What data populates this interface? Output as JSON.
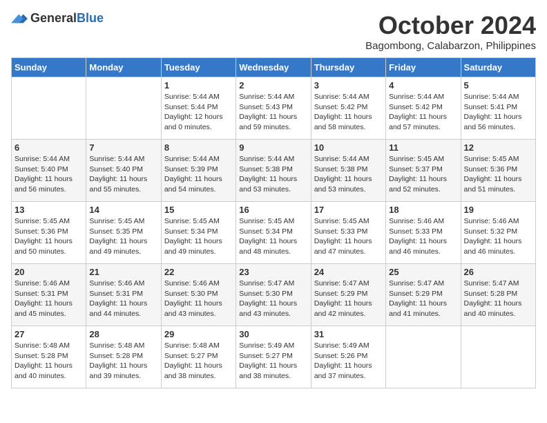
{
  "header": {
    "logo_general": "General",
    "logo_blue": "Blue",
    "month_title": "October 2024",
    "location": "Bagombong, Calabarzon, Philippines"
  },
  "days_of_week": [
    "Sunday",
    "Monday",
    "Tuesday",
    "Wednesday",
    "Thursday",
    "Friday",
    "Saturday"
  ],
  "weeks": [
    [
      {
        "day": "",
        "info": ""
      },
      {
        "day": "",
        "info": ""
      },
      {
        "day": "1",
        "info": "Sunrise: 5:44 AM\nSunset: 5:44 PM\nDaylight: 12 hours\nand 0 minutes."
      },
      {
        "day": "2",
        "info": "Sunrise: 5:44 AM\nSunset: 5:43 PM\nDaylight: 11 hours\nand 59 minutes."
      },
      {
        "day": "3",
        "info": "Sunrise: 5:44 AM\nSunset: 5:42 PM\nDaylight: 11 hours\nand 58 minutes."
      },
      {
        "day": "4",
        "info": "Sunrise: 5:44 AM\nSunset: 5:42 PM\nDaylight: 11 hours\nand 57 minutes."
      },
      {
        "day": "5",
        "info": "Sunrise: 5:44 AM\nSunset: 5:41 PM\nDaylight: 11 hours\nand 56 minutes."
      }
    ],
    [
      {
        "day": "6",
        "info": "Sunrise: 5:44 AM\nSunset: 5:40 PM\nDaylight: 11 hours\nand 56 minutes."
      },
      {
        "day": "7",
        "info": "Sunrise: 5:44 AM\nSunset: 5:40 PM\nDaylight: 11 hours\nand 55 minutes."
      },
      {
        "day": "8",
        "info": "Sunrise: 5:44 AM\nSunset: 5:39 PM\nDaylight: 11 hours\nand 54 minutes."
      },
      {
        "day": "9",
        "info": "Sunrise: 5:44 AM\nSunset: 5:38 PM\nDaylight: 11 hours\nand 53 minutes."
      },
      {
        "day": "10",
        "info": "Sunrise: 5:44 AM\nSunset: 5:38 PM\nDaylight: 11 hours\nand 53 minutes."
      },
      {
        "day": "11",
        "info": "Sunrise: 5:45 AM\nSunset: 5:37 PM\nDaylight: 11 hours\nand 52 minutes."
      },
      {
        "day": "12",
        "info": "Sunrise: 5:45 AM\nSunset: 5:36 PM\nDaylight: 11 hours\nand 51 minutes."
      }
    ],
    [
      {
        "day": "13",
        "info": "Sunrise: 5:45 AM\nSunset: 5:36 PM\nDaylight: 11 hours\nand 50 minutes."
      },
      {
        "day": "14",
        "info": "Sunrise: 5:45 AM\nSunset: 5:35 PM\nDaylight: 11 hours\nand 49 minutes."
      },
      {
        "day": "15",
        "info": "Sunrise: 5:45 AM\nSunset: 5:34 PM\nDaylight: 11 hours\nand 49 minutes."
      },
      {
        "day": "16",
        "info": "Sunrise: 5:45 AM\nSunset: 5:34 PM\nDaylight: 11 hours\nand 48 minutes."
      },
      {
        "day": "17",
        "info": "Sunrise: 5:45 AM\nSunset: 5:33 PM\nDaylight: 11 hours\nand 47 minutes."
      },
      {
        "day": "18",
        "info": "Sunrise: 5:46 AM\nSunset: 5:33 PM\nDaylight: 11 hours\nand 46 minutes."
      },
      {
        "day": "19",
        "info": "Sunrise: 5:46 AM\nSunset: 5:32 PM\nDaylight: 11 hours\nand 46 minutes."
      }
    ],
    [
      {
        "day": "20",
        "info": "Sunrise: 5:46 AM\nSunset: 5:31 PM\nDaylight: 11 hours\nand 45 minutes."
      },
      {
        "day": "21",
        "info": "Sunrise: 5:46 AM\nSunset: 5:31 PM\nDaylight: 11 hours\nand 44 minutes."
      },
      {
        "day": "22",
        "info": "Sunrise: 5:46 AM\nSunset: 5:30 PM\nDaylight: 11 hours\nand 43 minutes."
      },
      {
        "day": "23",
        "info": "Sunrise: 5:47 AM\nSunset: 5:30 PM\nDaylight: 11 hours\nand 43 minutes."
      },
      {
        "day": "24",
        "info": "Sunrise: 5:47 AM\nSunset: 5:29 PM\nDaylight: 11 hours\nand 42 minutes."
      },
      {
        "day": "25",
        "info": "Sunrise: 5:47 AM\nSunset: 5:29 PM\nDaylight: 11 hours\nand 41 minutes."
      },
      {
        "day": "26",
        "info": "Sunrise: 5:47 AM\nSunset: 5:28 PM\nDaylight: 11 hours\nand 40 minutes."
      }
    ],
    [
      {
        "day": "27",
        "info": "Sunrise: 5:48 AM\nSunset: 5:28 PM\nDaylight: 11 hours\nand 40 minutes."
      },
      {
        "day": "28",
        "info": "Sunrise: 5:48 AM\nSunset: 5:28 PM\nDaylight: 11 hours\nand 39 minutes."
      },
      {
        "day": "29",
        "info": "Sunrise: 5:48 AM\nSunset: 5:27 PM\nDaylight: 11 hours\nand 38 minutes."
      },
      {
        "day": "30",
        "info": "Sunrise: 5:49 AM\nSunset: 5:27 PM\nDaylight: 11 hours\nand 38 minutes."
      },
      {
        "day": "31",
        "info": "Sunrise: 5:49 AM\nSunset: 5:26 PM\nDaylight: 11 hours\nand 37 minutes."
      },
      {
        "day": "",
        "info": ""
      },
      {
        "day": "",
        "info": ""
      }
    ]
  ]
}
